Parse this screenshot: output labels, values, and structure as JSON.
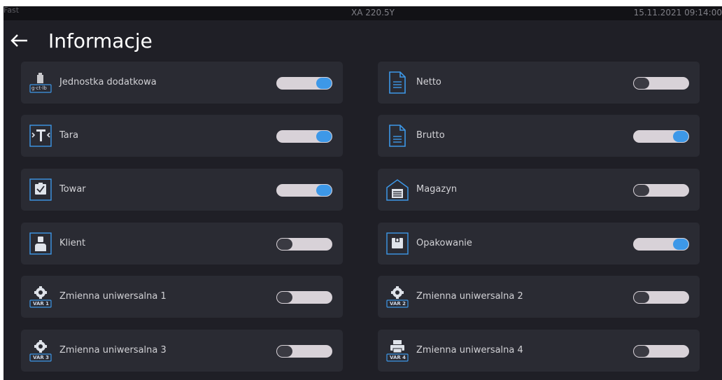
{
  "statusbar": {
    "left": "Fast",
    "center": "XA 220.5Y",
    "right": "15.11.2021 09:14:00"
  },
  "header": {
    "title": "Informacje"
  },
  "items": [
    {
      "label": "Jednostka dodatkowa",
      "icon": "unit-g-ct-lb-icon",
      "enabled": true,
      "badge": "g·ct·lb"
    },
    {
      "label": "Netto",
      "icon": "document-icon",
      "enabled": false
    },
    {
      "label": "Tara",
      "icon": "tare-icon",
      "enabled": true
    },
    {
      "label": "Brutto",
      "icon": "document-icon",
      "enabled": true
    },
    {
      "label": "Towar",
      "icon": "product-box-icon",
      "enabled": true
    },
    {
      "label": "Magazyn",
      "icon": "warehouse-icon",
      "enabled": false
    },
    {
      "label": "Klient",
      "icon": "person-icon",
      "enabled": false
    },
    {
      "label": "Opakowanie",
      "icon": "package-icon",
      "enabled": true
    },
    {
      "label": "Zmienna uniwersalna 1",
      "icon": "variable-gear-icon",
      "enabled": false,
      "badge": "VAR 1"
    },
    {
      "label": "Zmienna uniwersalna 2",
      "icon": "variable-gear-icon",
      "enabled": false,
      "badge": "VAR 2"
    },
    {
      "label": "Zmienna uniwersalna 3",
      "icon": "variable-gear-icon",
      "enabled": false,
      "badge": "VAR 3"
    },
    {
      "label": "Zmienna uniwersalna 4",
      "icon": "variable-printer-icon",
      "enabled": false,
      "badge": "VAR 4"
    }
  ],
  "colors": {
    "accent": "#3d98e8",
    "card": "#2a2b33",
    "background": "#1f1f26"
  }
}
